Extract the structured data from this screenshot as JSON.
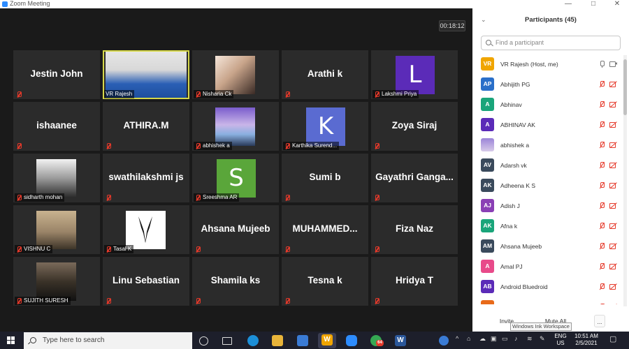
{
  "window": {
    "title": "Zoom Meeting",
    "minimize": "—",
    "maximize": "□",
    "close": "✕"
  },
  "meeting": {
    "timer": "00:18:12"
  },
  "tiles": [
    {
      "kind": "name",
      "name": "Jestin John"
    },
    {
      "kind": "photo",
      "label": "VR Rajesh",
      "active": true,
      "photo": "man-with-glasses"
    },
    {
      "kind": "photo",
      "label": "Nisharia Ck",
      "photo": "couple"
    },
    {
      "kind": "name",
      "name": "Arathi k"
    },
    {
      "kind": "avatar",
      "letter": "L",
      "color": "#5b2bb8",
      "label": "Lakshmi Priya"
    },
    {
      "kind": "name",
      "name": "ishaanee"
    },
    {
      "kind": "name",
      "name": "ATHIRA.M"
    },
    {
      "kind": "photo",
      "label": "abhishek a",
      "photo": "sky-scene"
    },
    {
      "kind": "avatar",
      "letter": "K",
      "color": "#5a6bd1",
      "label": "Karthika Surend..."
    },
    {
      "kind": "name",
      "name": "Zoya Siraj"
    },
    {
      "kind": "photo",
      "label": "sidharth mohan",
      "photo": "motorbike"
    },
    {
      "kind": "name",
      "name": "swathilakshmi js"
    },
    {
      "kind": "avatar",
      "letter": "S",
      "color": "#5aa63a",
      "label": "Sreeshma AR"
    },
    {
      "kind": "name",
      "name": "Sumi b"
    },
    {
      "kind": "name",
      "name": "Gayathri  Ganga..."
    },
    {
      "kind": "photo",
      "label": "VISHNU C",
      "photo": "lion"
    },
    {
      "kind": "photo",
      "label": "Tasal K",
      "photo": "antelope-logo"
    },
    {
      "kind": "name",
      "name": "Ahsana Mujeeb"
    },
    {
      "kind": "name",
      "name": "MUHAMMED..."
    },
    {
      "kind": "name",
      "name": "Fiza Naz"
    },
    {
      "kind": "photo",
      "label": "SUJITH SURESH",
      "photo": "harry-potter"
    },
    {
      "kind": "name",
      "name": "Linu Sebastian"
    },
    {
      "kind": "name",
      "name": "Shamila ks"
    },
    {
      "kind": "name",
      "name": "Tesna k"
    },
    {
      "kind": "name",
      "name": "Hridya T"
    }
  ],
  "panel": {
    "title": "Participants (45)",
    "search_placeholder": "Find a participant",
    "participants": [
      {
        "initials": "VR",
        "color": "#f0a500",
        "name": "VR Rajesh (Host, me)",
        "muted": false,
        "video": true
      },
      {
        "initials": "AP",
        "color": "#2a6fc9",
        "name": "Abhijith PG",
        "muted": true,
        "video": false
      },
      {
        "initials": "A",
        "color": "#1aa57a",
        "name": "Abhinav",
        "muted": true,
        "video": false
      },
      {
        "initials": "A",
        "color": "#5b2bb8",
        "name": "ABHINAV AK",
        "muted": true,
        "video": false
      },
      {
        "initials": "",
        "color": "#b9a6d6",
        "name": "abhishek a",
        "muted": true,
        "video": false,
        "photo": true
      },
      {
        "initials": "AV",
        "color": "#3a4a5c",
        "name": "Adarsh vk",
        "muted": true,
        "video": false
      },
      {
        "initials": "AK",
        "color": "#3a4a5c",
        "name": "Adheena K S",
        "muted": true,
        "video": false
      },
      {
        "initials": "AJ",
        "color": "#8a3fb5",
        "name": "Adish J",
        "muted": true,
        "video": false
      },
      {
        "initials": "AK",
        "color": "#1aa57a",
        "name": "Afna k",
        "muted": true,
        "video": false
      },
      {
        "initials": "AM",
        "color": "#3a4a5c",
        "name": "Ahsana Mujeeb",
        "muted": true,
        "video": false
      },
      {
        "initials": "A",
        "color": "#e84a8a",
        "name": "Amal PJ",
        "muted": true,
        "video": false
      },
      {
        "initials": "AB",
        "color": "#5b2bb8",
        "name": "Android Bluedroid",
        "muted": true,
        "video": false
      },
      {
        "initials": "",
        "color": "#e86a1a",
        "name": "",
        "muted": true,
        "video": false
      }
    ],
    "invite_label": "Invite",
    "mute_all_label": "Mute All",
    "more_label": "...",
    "tooltip": "Windows Ink Workspace"
  },
  "taskbar": {
    "search_placeholder": "Type here to search",
    "language": "ENG",
    "region": "US",
    "time": "10:51 AM",
    "date": "2/5/2021",
    "chrome_badge": "64",
    "apps": [
      "task-view-icon",
      "edge-icon",
      "file-explorer-icon",
      "store-icon",
      "whiteboard-icon",
      "zoom-icon",
      "chrome-icon",
      "word-icon"
    ]
  }
}
